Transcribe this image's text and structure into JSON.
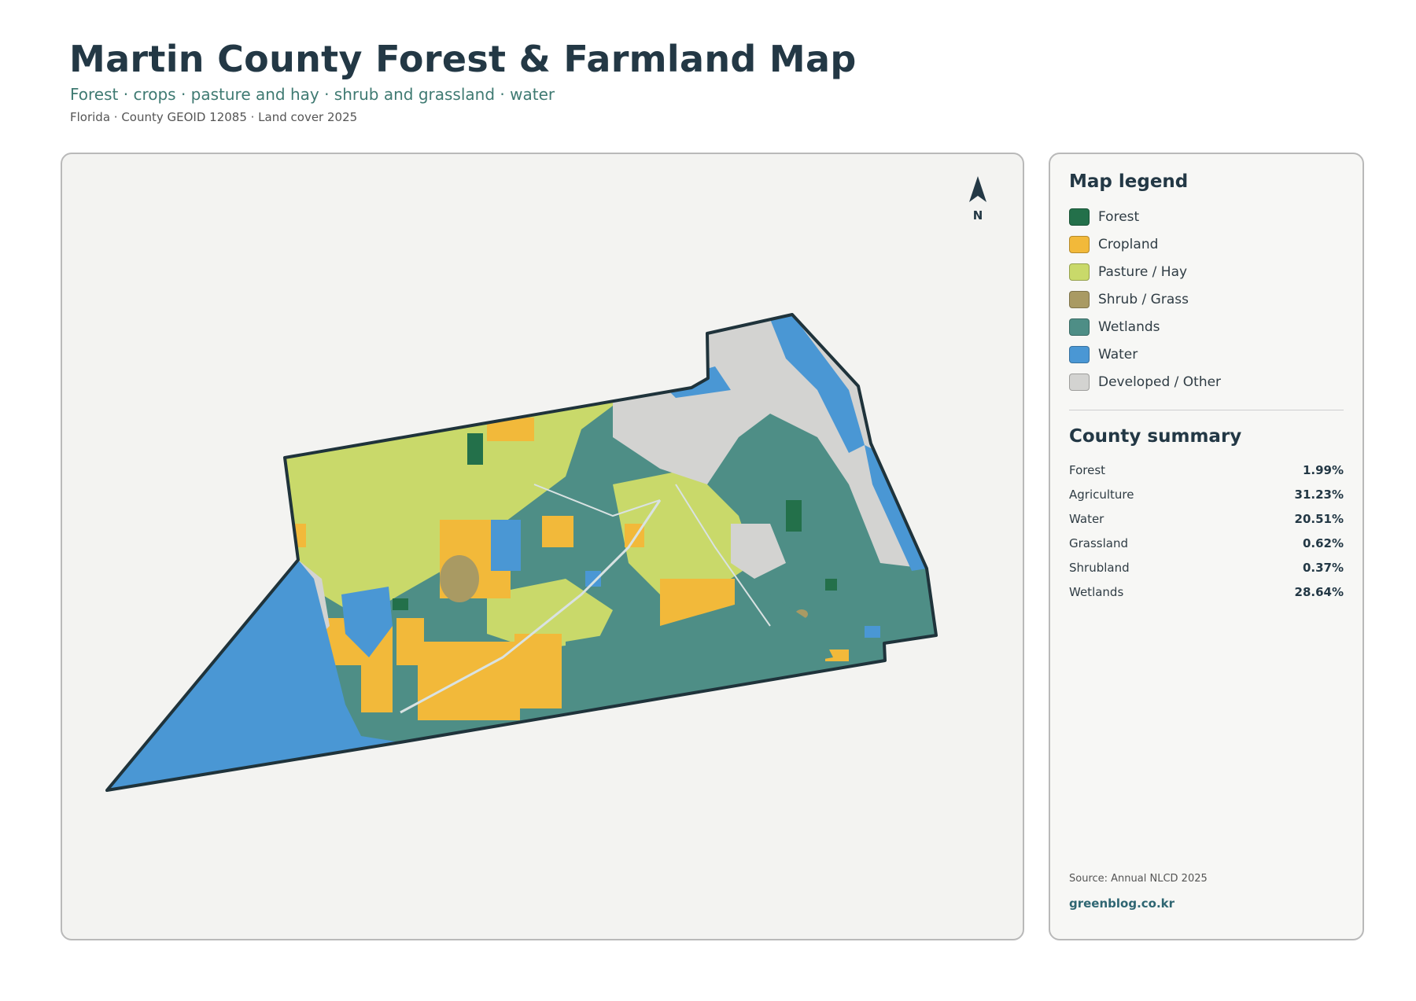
{
  "header": {
    "title": "Martin County Forest & Farmland Map",
    "subtitle": "Forest · crops · pasture and hay · shrub and grassland · water",
    "meta": "Florida · County GEOID 12085 · Land cover 2025"
  },
  "map": {
    "north_label": "N",
    "colors": {
      "forest": "#23704a",
      "cropland": "#f2b93a",
      "pasture": "#c9d96a",
      "shrub": "#a99a63",
      "wetlands": "#4e8e86",
      "water": "#4a97d4",
      "developed": "#d3d3d1",
      "outline": "#1f333b"
    }
  },
  "legend": {
    "heading": "Map legend",
    "items": [
      {
        "label": "Forest",
        "color": "#23704a"
      },
      {
        "label": "Cropland",
        "color": "#f2b93a"
      },
      {
        "label": "Pasture / Hay",
        "color": "#c9d96a"
      },
      {
        "label": "Shrub / Grass",
        "color": "#a99a63"
      },
      {
        "label": "Wetlands",
        "color": "#4e8e86"
      },
      {
        "label": "Water",
        "color": "#4a97d4"
      },
      {
        "label": "Developed / Other",
        "color": "#d3d3d1"
      }
    ]
  },
  "summary": {
    "heading": "County summary",
    "rows": [
      {
        "label": "Forest",
        "value": "1.99%"
      },
      {
        "label": "Agriculture",
        "value": "31.23%"
      },
      {
        "label": "Water",
        "value": "20.51%"
      },
      {
        "label": "Grassland",
        "value": "0.62%"
      },
      {
        "label": "Shrubland",
        "value": "0.37%"
      },
      {
        "label": "Wetlands",
        "value": "28.64%"
      }
    ]
  },
  "footer": {
    "source": "Source: Annual NLCD 2025",
    "brand": "greenblog.co.kr"
  }
}
